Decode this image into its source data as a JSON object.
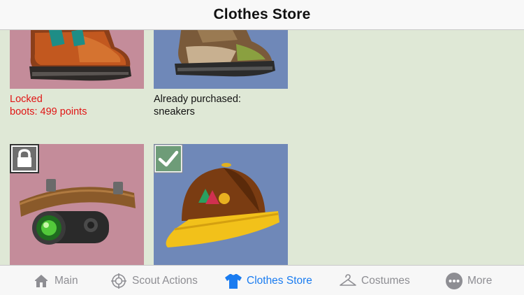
{
  "app": {
    "title": "Clothes Store"
  },
  "items": [
    {
      "name": "boots",
      "status": "locked",
      "caption_line1": "Locked",
      "caption_line2": "boots: 499 points",
      "tile_color": "#c48c9a"
    },
    {
      "name": "sneakers",
      "status": "purchased",
      "caption_line1": "Already purchased:",
      "caption_line2": "sneakers",
      "tile_color": "#6f88b8"
    },
    {
      "name": "headlamp",
      "status": "locked",
      "tile_color": "#c48c9a"
    },
    {
      "name": "cap",
      "status": "purchased",
      "tile_color": "#6f88b8"
    }
  ],
  "tabbar": {
    "tabs": [
      {
        "label": "Main",
        "icon": "house-icon",
        "active": false
      },
      {
        "label": "Scout Actions",
        "icon": "compass-icon",
        "active": false
      },
      {
        "label": "Clothes Store",
        "icon": "shirt-icon",
        "active": true
      },
      {
        "label": "Costumes",
        "icon": "hanger-icon",
        "active": false
      },
      {
        "label": "More",
        "icon": "more-dots-icon",
        "active": false
      }
    ]
  },
  "colors": {
    "background": "#dfe8d6",
    "locked_text": "#e01515",
    "accent_blue": "#1a7cf0",
    "tab_inactive": "#8e8e93",
    "locked_tile": "#c48c9a",
    "purchased_tile": "#6f88b8"
  }
}
